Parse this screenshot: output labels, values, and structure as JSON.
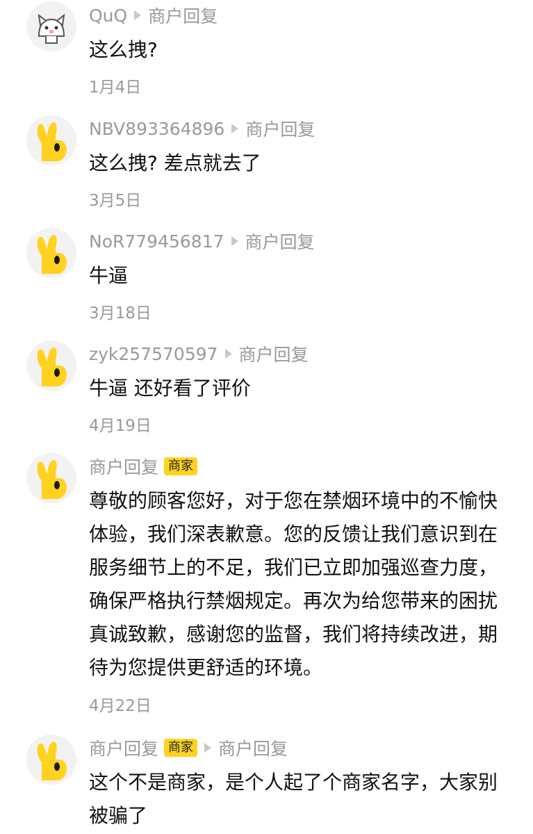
{
  "comments": [
    {
      "avatar": "cat-avatar-icon",
      "username": "QuQ",
      "reply_label": "商户回复",
      "text": "这么拽?",
      "date": "1月4日"
    },
    {
      "avatar": "yellow-hand-avatar-icon",
      "username": "NBV893364896",
      "reply_label": "商户回复",
      "text": "这么拽? 差点就去了",
      "date": "3月5日"
    },
    {
      "avatar": "yellow-hand-avatar-icon",
      "username": "NoR779456817",
      "reply_label": "商户回复",
      "text": "牛逼",
      "date": "3月18日"
    },
    {
      "avatar": "yellow-hand-avatar-icon",
      "username": "zyk257570597",
      "reply_label": "商户回复",
      "text": "牛逼 还好看了评价",
      "date": "4月19日"
    },
    {
      "avatar": "yellow-hand-avatar-icon",
      "username": "商户回复",
      "badge": "商家",
      "text": "尊敬的顾客您好，对于您在禁烟环境中的不愉快体验，我们深表歉意。您的反馈让我们意识到在服务细节上的不足，我们已立即加强巡查力度，确保严格执行禁烟规定。再次为给您带来的困扰真诚致歉，感谢您的监督，我们将持续改进，期待为您提供更舒适的环境。",
      "date": "4月22日"
    },
    {
      "avatar": "yellow-hand-avatar-icon",
      "username": "商户回复",
      "badge": "商家",
      "reply_label": "商户回复",
      "text": "这个不是商家，是个人起了个商家名字，大家别被骗了",
      "date": ""
    }
  ]
}
